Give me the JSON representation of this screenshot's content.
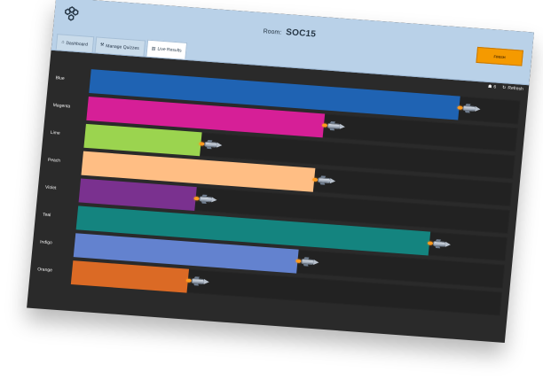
{
  "header": {
    "tabs": [
      {
        "label": "Dashboard",
        "icon": "home-icon"
      },
      {
        "label": "Manage Quizzes",
        "icon": "wrench-icon"
      },
      {
        "label": "Live Results",
        "icon": "stats-icon"
      }
    ],
    "room_label": "Room:",
    "room_code": "SOC15",
    "finish_label": "FINISH"
  },
  "status": {
    "participants": "6",
    "refresh_label": "Refresh"
  },
  "race": {
    "lanes": [
      {
        "name": "Blue",
        "progress": 0.86,
        "color": "#1f63b3"
      },
      {
        "name": "Magenta",
        "progress": 0.55,
        "color": "#d61f97"
      },
      {
        "name": "Lime",
        "progress": 0.27,
        "color": "#9bd44f"
      },
      {
        "name": "Peach",
        "progress": 0.54,
        "color": "#ffbe84"
      },
      {
        "name": "Violet",
        "progress": 0.27,
        "color": "#7a318f"
      },
      {
        "name": "Teal",
        "progress": 0.82,
        "color": "#14847f"
      },
      {
        "name": "Indigo",
        "progress": 0.52,
        "color": "#6382cf"
      },
      {
        "name": "Orange",
        "progress": 0.27,
        "color": "#db6a25"
      }
    ]
  },
  "colors": {
    "topbar": "#b9d1e8",
    "race_background": "#2a2a2a",
    "track": "#222222",
    "finish_button": "#f59a00"
  }
}
